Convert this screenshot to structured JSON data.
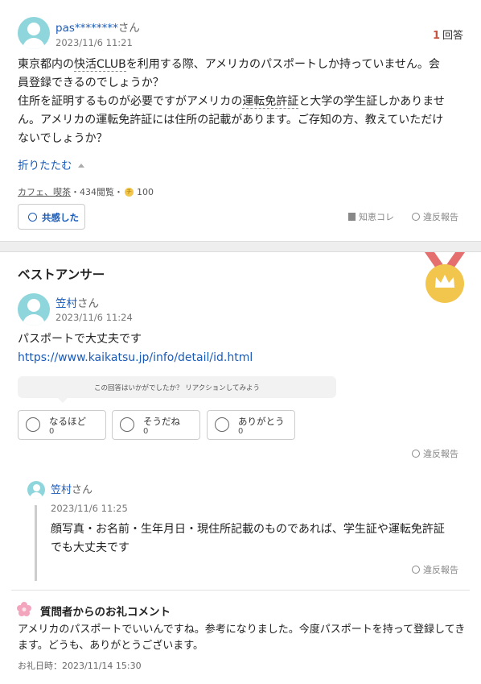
{
  "question": {
    "user_name": "pas********",
    "san": "さん",
    "date": "2023/11/6 11:21",
    "answer_count": "1",
    "answer_count_label": "回答",
    "line1_pre": "東京都内の",
    "line1_link": "快活CLUB",
    "line1_post": "を利用する際、アメリカのパスポートしか持っていません。会",
    "line2": "員登録できるのでしょうか？",
    "line3_pre": "住所を証明するものが必要ですがアメリカの",
    "line3_link": "運転免許証",
    "line3_post": "と大学の学生証しかありませ",
    "line4": "ん。アメリカの運転免許証には住所の記載があります。ご存知の方、教えていただけ",
    "line5": "ないでしょうか？",
    "collapse_label": "折りたたむ",
    "category": "カフェ、喫茶",
    "views": "・434閲覧・",
    "coins": "100",
    "empathy_button": "共感した",
    "save_label": "知恵コレ",
    "report_label": "違反報告"
  },
  "best_answer": {
    "heading": "ベストアンサー",
    "user_name": "笠村",
    "san": "さん",
    "date": "2023/11/6 11:24",
    "body": "パスポートで大丈夫です",
    "url": "https://www.kaikatsu.jp/info/detail/id.html",
    "reaction_prompt": "この回答はいかがでしたか？ リアクションしてみよう",
    "reactions": [
      {
        "label": "なるほど",
        "count": "0"
      },
      {
        "label": "そうだね",
        "count": "0"
      },
      {
        "label": "ありがとう",
        "count": "0"
      }
    ],
    "report_label": "違反報告"
  },
  "reply": {
    "user_name": "笠村",
    "san": "さん",
    "date": "2023/11/6 11:25",
    "line1": "顔写真・お名前・生年月日・現住所記載のものであれば、学生証や運転免許証",
    "line2": "でも大丈夫です",
    "report_label": "違反報告"
  },
  "thanks": {
    "title": "質問者からのお礼コメント",
    "line1": "アメリカのパスポートでいいんですね。参考になりました。今度パスポートを持って登録してき",
    "line2": "ます。どうも、ありがとうございます。",
    "date_label": "お礼日時：2023/11/14 15:30"
  },
  "colors": {
    "link": "#1b5bb8",
    "accent_red": "#c9543f",
    "avatar": "#8fd6dc",
    "medal": "#f2c64c"
  }
}
